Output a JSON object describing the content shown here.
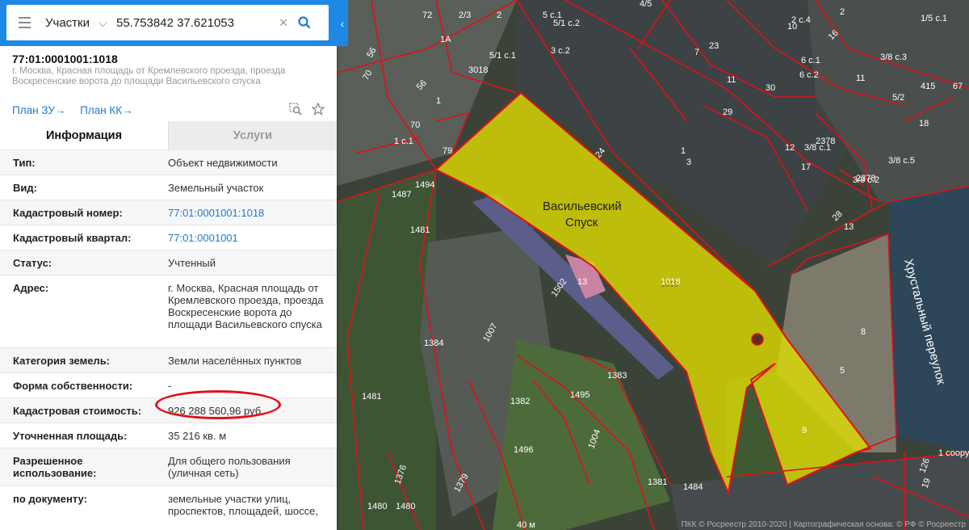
{
  "search": {
    "type_label": "Участки",
    "query": "55.753842 37.621053"
  },
  "object": {
    "title": "77:01:0001001:1018",
    "subtitle": "г. Москва, Красная площадь от Кремлевского проезда, проезда Воскресенские ворота до площади Васильевского спуска"
  },
  "links": {
    "plan_zu": "План ЗУ→",
    "plan_kk": "План КК→"
  },
  "tabs": {
    "info": "Информация",
    "services": "Услуги"
  },
  "rows": [
    {
      "label": "Тип:",
      "value": "Объект недвижимости"
    },
    {
      "label": "Вид:",
      "value": "Земельный участок"
    },
    {
      "label": "Кадастровый номер:",
      "value": "77:01:0001001:1018"
    },
    {
      "label": "Кадастровый квартал:",
      "value": "77:01:0001001"
    },
    {
      "label": "Статус:",
      "value": "Учтенный"
    },
    {
      "label": "Адрес:",
      "value": "г. Москва, Красная площадь от Кремлевского проезда, проезда Воскресенские ворота до площади Васильевского спуска"
    },
    {
      "label": "Категория земель:",
      "value": "Земли населённых пунктов"
    },
    {
      "label": "Форма собственности:",
      "value": "-"
    },
    {
      "label": "Кадастровая стоимость:",
      "value": "926 288 560,96 руб."
    },
    {
      "label": "Уточненная площадь:",
      "value": "35 216 кв. м"
    },
    {
      "label": "Разрешенное использование:",
      "value": "Для общего пользования (уличная сеть)"
    },
    {
      "label": "по документу:",
      "value": "земельные участки улиц, проспектов, площадей, шоссе,"
    }
  ],
  "map": {
    "area_name_line1": "Васильевский",
    "area_name_line2": "Спуск",
    "parcel_number": "1018",
    "street_label": "Хрустальный переулок",
    "scale": "40 м",
    "copyright": "ПКК © Росреестр 2010-2020 | Картографическая основа: © РФ © Росреестр",
    "parcel_labels": [
      "72",
      "2/3",
      "2",
      "5 с.1",
      "5/1 с.2",
      "4/5",
      "2 с.4",
      "2",
      "10",
      "16",
      "1/5 с.1",
      "1А",
      "5/1 с.1",
      "3 с.2",
      "7",
      "23",
      "6 с.1",
      "3/8 с.3",
      "56",
      "3018",
      "1",
      "11",
      "30",
      "6 с.2",
      "11",
      "5/2",
      "415",
      "67",
      "70",
      "56",
      "70",
      "29",
      "18",
      "2378",
      "3/8 с.1",
      "12",
      "1 с.1",
      "79",
      "24",
      "1",
      "3",
      "17",
      "3/8 с.5",
      "1494",
      "2378",
      "3/8 с.2",
      "1487",
      "28",
      "13",
      "1481",
      "13",
      "1018",
      "1502",
      "8",
      "1384",
      "1007",
      "1383",
      "5",
      "1481",
      "1495",
      "1382",
      "9",
      "1496",
      "1004",
      "1 соору",
      "1376",
      "1379",
      "1381",
      "1484",
      "126",
      "19",
      "1480",
      "1480"
    ],
    "colors": {
      "parcel_fill": "#e3e000",
      "parcel_border": "#e0101a",
      "accent": "#1e88e5"
    }
  }
}
